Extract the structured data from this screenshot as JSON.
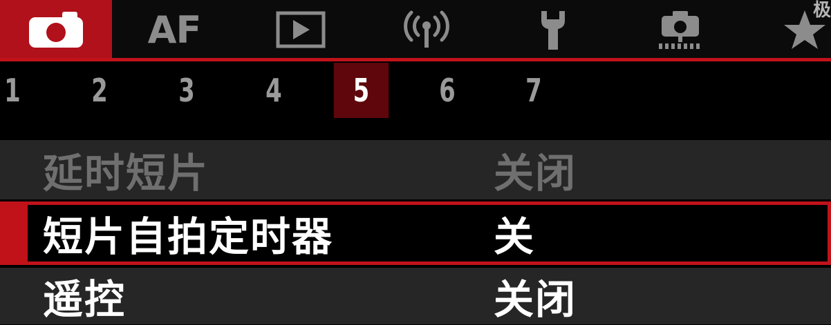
{
  "tabs": [
    {
      "id": "shooting",
      "icon": "camera-icon",
      "active": true
    },
    {
      "id": "af",
      "text": "AF",
      "active": false
    },
    {
      "id": "playback",
      "icon": "playback-icon",
      "active": false
    },
    {
      "id": "wireless",
      "icon": "wireless-icon",
      "active": false
    },
    {
      "id": "setup",
      "icon": "wrench-icon",
      "active": false
    },
    {
      "id": "custom",
      "icon": "custom-functions-icon",
      "active": false
    },
    {
      "id": "mymenu",
      "icon": "star-icon",
      "active": false
    }
  ],
  "corner_label": "极",
  "pages": [
    "1",
    "2",
    "3",
    "4",
    "5",
    "6",
    "7"
  ],
  "active_page": "5",
  "menu": [
    {
      "label": "延时短片",
      "value": "关闭",
      "state": "dimmed"
    },
    {
      "label": "短片自拍定时器",
      "value": "关",
      "state": "selected"
    },
    {
      "label": "遥控",
      "value": "关闭",
      "state": "normal"
    }
  ],
  "colors": {
    "accent": "#c1121a",
    "active_page_bg": "#5e060b",
    "row_bg": "#262626",
    "dim_text": "#6f6f6f",
    "tab_icon": "#8c8c8c"
  }
}
